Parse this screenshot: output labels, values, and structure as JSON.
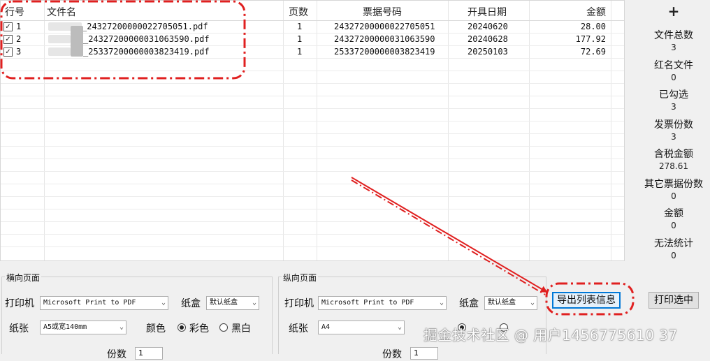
{
  "table": {
    "headers": {
      "row_no": "行号",
      "file_name": "文件名",
      "pages": "页数",
      "invoice_no": "票据号码",
      "issue_date": "开具日期",
      "amount": "金额"
    },
    "rows": [
      {
        "row_no": "1",
        "file_name": "_24327200000022705051.pdf",
        "pages": "1",
        "invoice_no": "24327200000022705051",
        "issue_date": "20240620",
        "amount": "28.00"
      },
      {
        "row_no": "2",
        "file_name": "_24327200000031063590.pdf",
        "pages": "1",
        "invoice_no": "24327200000031063590",
        "issue_date": "20240628",
        "amount": "177.92"
      },
      {
        "row_no": "3",
        "file_name": "_25337200000003823419.pdf",
        "pages": "1",
        "invoice_no": "25337200000003823419",
        "issue_date": "20250103",
        "amount": "72.69"
      }
    ]
  },
  "stats": {
    "add_label": "+",
    "items": [
      {
        "label": "文件总数",
        "value": "3"
      },
      {
        "label": "红名文件",
        "value": "0"
      },
      {
        "label": "已勾选",
        "value": "3"
      },
      {
        "label": "发票份数",
        "value": "3"
      },
      {
        "label": "含税金额",
        "value": "278.61"
      },
      {
        "label": "其它票据份数",
        "value": "0"
      },
      {
        "label": "金额",
        "value": "0"
      },
      {
        "label": "无法统计",
        "value": "0"
      }
    ]
  },
  "landscape": {
    "title": "横向页面",
    "printer_label": "打印机",
    "printer_value": "Microsoft Print to PDF",
    "tray_label": "纸盒",
    "tray_value": "默认纸盒",
    "paper_label": "纸张",
    "paper_value": "A5或宽140mm",
    "color_label": "颜色",
    "color_opt": "彩色",
    "bw_opt": "黑白",
    "copies_label": "份数",
    "copies_value": "1"
  },
  "portrait": {
    "title": "纵向页面",
    "printer_label": "打印机",
    "printer_value": "Microsoft Print to PDF",
    "tray_label": "纸盒",
    "tray_value": "默认纸盒",
    "paper_label": "纸张",
    "paper_value": "A4",
    "copies_label": "份数",
    "copies_value": "1"
  },
  "buttons": {
    "export": "导出列表信息",
    "print_selected": "打印选中"
  },
  "watermark": "掘金技术社区 @ 用户1456775610 37",
  "colors": {
    "annotation": "#e02020",
    "focus": "#0078d7"
  }
}
